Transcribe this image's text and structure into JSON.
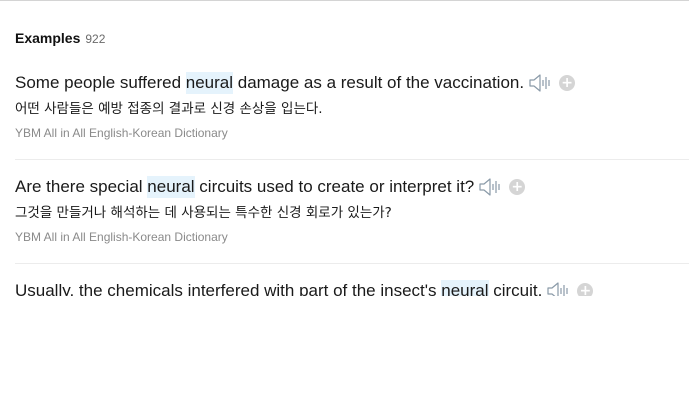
{
  "examples_header": {
    "title": "Examples",
    "count": "922"
  },
  "examples": [
    {
      "before": "Some people suffered ",
      "highlight": "neural",
      "after": " damage as a result of the vaccination.",
      "translation": "어떤 사람들은 예방 접종의 결과로 신경 손상을 입는다.",
      "source": "YBM All in All English-Korean Dictionary"
    },
    {
      "before": "Are there special ",
      "highlight": "neural",
      "after": " circuits used to create or interpret it?",
      "translation": "그것을 만들거나 해석하는 데 사용되는 특수한 신경 회로가 있는가?",
      "source": "YBM All in All English-Korean Dictionary"
    },
    {
      "before": "Usually, the chemicals interfered with part of the insect's ",
      "highlight": "neural",
      "after": " circuit.",
      "translation": "",
      "source": ""
    }
  ],
  "icons": {
    "audio": "speaker-icon",
    "add": "plus-icon",
    "add_glyph": "+"
  },
  "colors": {
    "highlight": "#e5f3fc",
    "speaker": "#8a9aa8",
    "add_button": "#d5d5d5",
    "source_text": "#8a8a8a"
  }
}
